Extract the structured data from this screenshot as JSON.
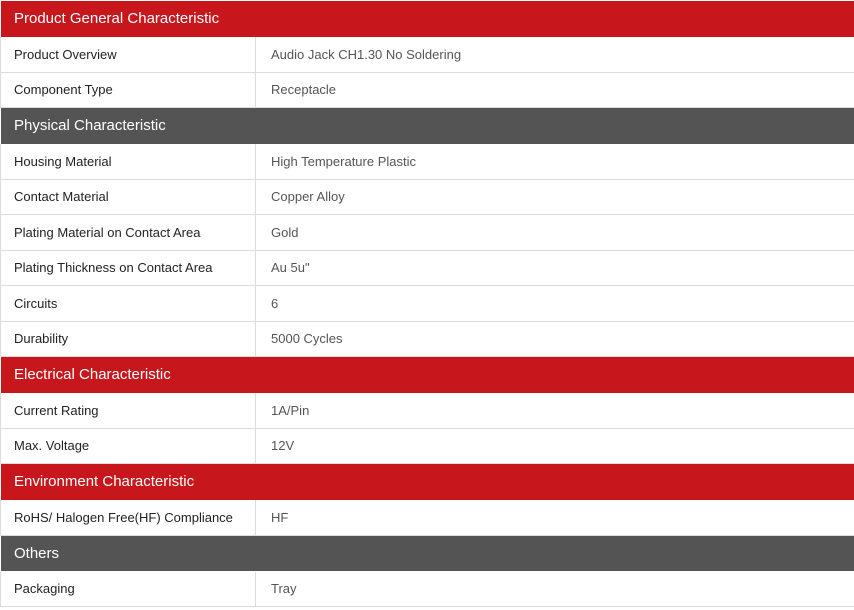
{
  "colors": {
    "accent": "#c8171c",
    "section_gray": "#545454",
    "border": "#dcdcdc"
  },
  "sections": [
    {
      "title": "Product General Characteristic",
      "style": "red",
      "rows": [
        {
          "label": "Product Overview",
          "value": "Audio Jack CH1.30 No Soldering"
        },
        {
          "label": "Component Type",
          "value": "Receptacle"
        }
      ]
    },
    {
      "title": "Physical Characteristic",
      "style": "gray",
      "rows": [
        {
          "label": "Housing Material",
          "value": "High Temperature Plastic"
        },
        {
          "label": "Contact Material",
          "value": "Copper Alloy"
        },
        {
          "label": "Plating Material on Contact Area",
          "value": "Gold"
        },
        {
          "label": "Plating Thickness on Contact Area",
          "value": "Au 5u\""
        },
        {
          "label": "Circuits",
          "value": "6"
        },
        {
          "label": "Durability",
          "value": "5000 Cycles"
        }
      ]
    },
    {
      "title": "Electrical Characteristic",
      "style": "red",
      "rows": [
        {
          "label": "Current Rating",
          "value": "1A/Pin"
        },
        {
          "label": "Max. Voltage",
          "value": "12V"
        }
      ]
    },
    {
      "title": "Environment Characteristic",
      "style": "red",
      "rows": [
        {
          "label": "RoHS/ Halogen Free(HF) Compliance",
          "value": "HF"
        }
      ]
    },
    {
      "title": "Others",
      "style": "gray",
      "rows": [
        {
          "label": "Packaging",
          "value": "Tray"
        }
      ]
    }
  ]
}
